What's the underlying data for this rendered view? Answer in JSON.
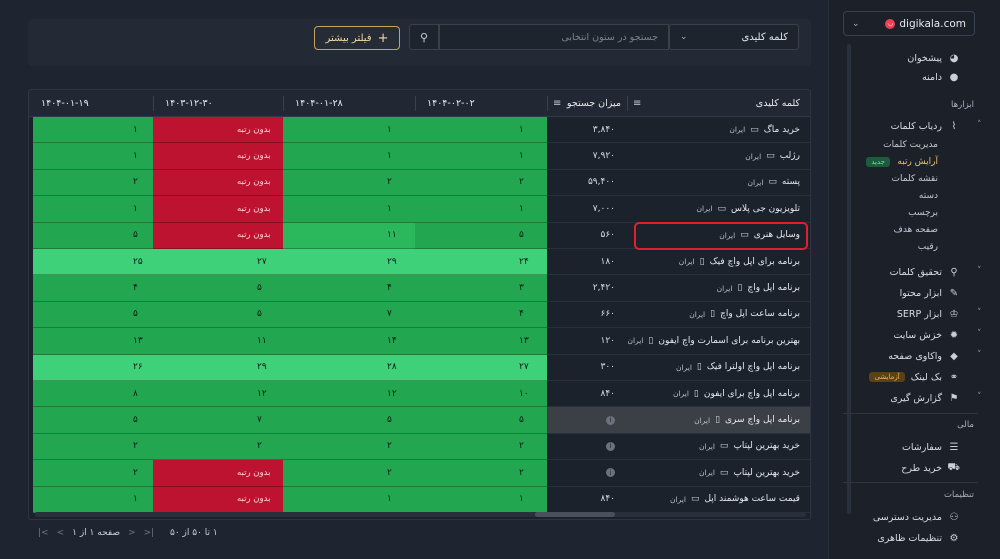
{
  "sidebar": {
    "domain": "digikala.com",
    "items": {
      "dashboard": "پیشخوان",
      "domain": "دامنه",
      "tools_heading": "ابزارها",
      "rank_tracker": "ردیاب کلمات",
      "rank_sub": [
        "مدیریت کلمات",
        "آرایش رتبه",
        "نقشه کلمات",
        "دسته",
        "برچسب",
        "صفحه هدف",
        "رقیب"
      ],
      "new_badge": "جدید",
      "keyword_research": "تحقیق کلمات",
      "content_tool": "ابزار محتوا",
      "serp_tool": "ابزار SERP",
      "site_crawl": "خزش سایت",
      "page_audit": "واکاوی صفحه",
      "backlink": "بک لینک",
      "beta_badge": "آزمایشی",
      "reporting": "گزارش گیری",
      "finance_heading": "مالی",
      "orders": "سفارشات",
      "buy_plan": "خرید طرح",
      "settings_heading": "تنظیمات",
      "access": "مدیریت دسترسی",
      "appearance": "تنظیمات ظاهری"
    }
  },
  "filter": {
    "keyword_select": "کلمه کلیدی",
    "search_placeholder": "جستجو در ستون انتخابی",
    "more_filter": "فیلتر بیشتر"
  },
  "table": {
    "headers": {
      "keyword": "کلمه کلیدی",
      "volume": "میزان جستجو",
      "d1": "۱۴۰۴-۰۲-۰۲",
      "d2": "۱۴۰۴-۰۱-۲۸",
      "d3": "۱۴۰۳-۱۲-۳۰",
      "d4": "۱۴۰۴-۰۱-۱۹"
    },
    "no_rank": "بدون رتبه",
    "rows": [
      {
        "kw": "خرید ماگ",
        "loc": "ایران",
        "dev": "desktop",
        "vol": "۳,۸۴۰",
        "d1": "۱",
        "d2": "۱",
        "d3": "بدون رتبه",
        "d4": "۱",
        "c": [
          "g",
          "g",
          "r",
          "g"
        ]
      },
      {
        "kw": "رژلب",
        "loc": "ایران",
        "dev": "desktop",
        "vol": "۷,۹۲۰",
        "d1": "۱",
        "d2": "۱",
        "d3": "بدون رتبه",
        "d4": "۱",
        "c": [
          "g",
          "g",
          "r",
          "g"
        ]
      },
      {
        "kw": "پسته",
        "loc": "ایران",
        "dev": "desktop",
        "vol": "۵۹,۴۰۰",
        "d1": "۲",
        "d2": "۲",
        "d3": "بدون رتبه",
        "d4": "۲",
        "c": [
          "g",
          "g",
          "r",
          "g"
        ]
      },
      {
        "kw": "تلویزیون جی پلاس",
        "loc": "ایران",
        "dev": "desktop",
        "vol": "۷,۰۰۰",
        "d1": "۱",
        "d2": "۱",
        "d3": "بدون رتبه",
        "d4": "۱",
        "c": [
          "g",
          "g",
          "r",
          "g"
        ]
      },
      {
        "kw": "وسایل هنری",
        "loc": "ایران",
        "dev": "desktop",
        "vol": "۵۶۰",
        "d1": "۵",
        "d2": "۱۱",
        "d3": "بدون رتبه",
        "d4": "۵",
        "c": [
          "g",
          "m",
          "r",
          "g"
        ]
      },
      {
        "kw": "برنامه برای اپل واچ فیک",
        "loc": "ایران",
        "dev": "mobile",
        "vol": "۱۸۰",
        "d1": "۲۴",
        "d2": "۲۹",
        "d3": "۲۷",
        "d4": "۲۵",
        "c": [
          "l",
          "l",
          "l",
          "l"
        ]
      },
      {
        "kw": "برنامه اپل واچ",
        "loc": "ایران",
        "dev": "mobile",
        "vol": "۲,۴۲۰",
        "d1": "۳",
        "d2": "۴",
        "d3": "۵",
        "d4": "۴",
        "c": [
          "g",
          "g",
          "g",
          "g"
        ]
      },
      {
        "kw": "برنامه ساعت اپل واچ",
        "loc": "ایران",
        "dev": "mobile",
        "vol": "۶۶۰",
        "d1": "۴",
        "d2": "۷",
        "d3": "۵",
        "d4": "۵",
        "c": [
          "g",
          "g",
          "g",
          "g"
        ]
      },
      {
        "kw": "بهترین برنامه برای اسمارت واچ ایفون",
        "loc": "ایران",
        "dev": "mobile",
        "vol": "۱۲۰",
        "d1": "۱۳",
        "d2": "۱۴",
        "d3": "۱۱",
        "d4": "۱۳",
        "c": [
          "g",
          "g",
          "g",
          "g"
        ]
      },
      {
        "kw": "برنامه اپل واچ اولترا فیک",
        "loc": "ایران",
        "dev": "mobile",
        "vol": "۳۰۰",
        "d1": "۲۷",
        "d2": "۲۸",
        "d3": "۲۹",
        "d4": "۲۶",
        "c": [
          "l",
          "l",
          "l",
          "l"
        ]
      },
      {
        "kw": "برنامه اپل واچ برای ایفون",
        "loc": "ایران",
        "dev": "mobile",
        "vol": "۸۴۰",
        "d1": "۱۰",
        "d2": "۱۲",
        "d3": "۱۲",
        "d4": "۸",
        "c": [
          "g",
          "g",
          "g",
          "g"
        ]
      },
      {
        "kw": "برنامه اپل واچ سری",
        "loc": "ایران",
        "dev": "mobile",
        "vol": "",
        "d1": "۵",
        "d2": "۵",
        "d3": "۷",
        "d4": "۵",
        "c": [
          "g",
          "g",
          "g",
          "g"
        ],
        "hl": true
      },
      {
        "kw": "خرید بهترین لپتاپ",
        "loc": "ایران",
        "dev": "desktop",
        "vol": "",
        "d1": "۲",
        "d2": "۲",
        "d3": "۲",
        "d4": "۲",
        "c": [
          "g",
          "g",
          "g",
          "g"
        ]
      },
      {
        "kw": "خرید بهترین لپتاپ",
        "loc": "ایران",
        "dev": "desktop",
        "vol": "",
        "d1": "۲",
        "d2": "۲",
        "d3": "بدون رتبه",
        "d4": "۲",
        "c": [
          "g",
          "g",
          "r",
          "g"
        ]
      },
      {
        "kw": "قیمت ساعت هوشمند اپل",
        "loc": "ایران",
        "dev": "desktop",
        "vol": "۸۴۰",
        "d1": "۱",
        "d2": "۱",
        "d3": "بدون رتبه",
        "d4": "۱",
        "c": [
          "g",
          "g",
          "r",
          "g"
        ]
      }
    ]
  },
  "pager": {
    "count": "۱ تا ۵۰ از ۵۰",
    "page": "صفحه ۱ از ۱"
  },
  "colors": {
    "green": "#22a64f",
    "light_green": "#3fd17a",
    "red": "#bd1331",
    "highlight_border": "#e0202e",
    "accent": "#c9a25a"
  }
}
